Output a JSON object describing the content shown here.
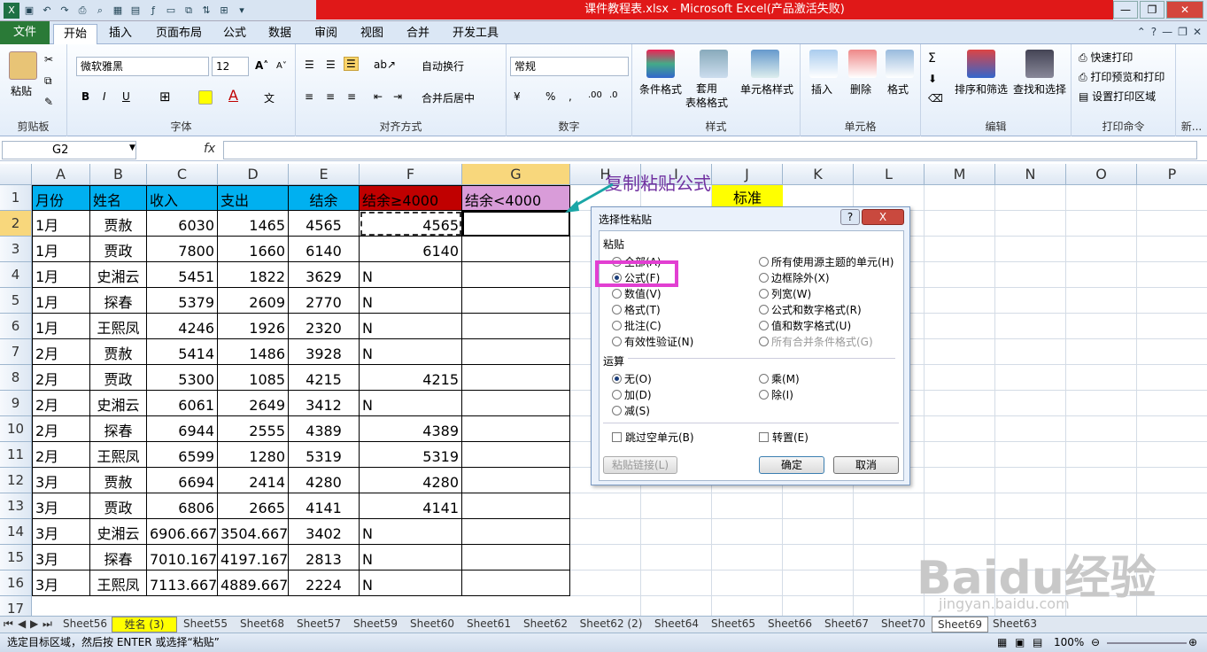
{
  "window": {
    "title": "课件教程表.xlsx - Microsoft Excel(产品激活失败)"
  },
  "ribbon": {
    "tabs": [
      "文件",
      "开始",
      "插入",
      "页面布局",
      "公式",
      "数据",
      "审阅",
      "视图",
      "合并",
      "开发工具"
    ],
    "groups": {
      "clipboard": {
        "label": "剪贴板",
        "paste": "粘贴"
      },
      "font": {
        "label": "字体",
        "name": "微软雅黑",
        "size": "12",
        "bold": "B",
        "italic": "I",
        "underline": "U"
      },
      "align": {
        "label": "对齐方式",
        "wrap": "自动换行",
        "merge": "合并后居中"
      },
      "number": {
        "label": "数字",
        "format": "常规"
      },
      "styles": {
        "label": "样式",
        "cond": "条件格式",
        "table": "套用\n表格格式",
        "cellstyle": "单元格样式"
      },
      "cells": {
        "label": "单元格",
        "insert": "插入",
        "delete": "删除",
        "format": "格式"
      },
      "edit": {
        "label": "编辑",
        "sort": "排序和筛选",
        "find": "查找和选择"
      },
      "print": {
        "label": "打印命令",
        "quick": "快速打印",
        "preview": "打印预览和打印",
        "area": "设置打印区域"
      },
      "more": {
        "label": "新..."
      }
    }
  },
  "formula_bar": {
    "name_box": "G2",
    "fx": "fx",
    "value": ""
  },
  "columns": [
    "A",
    "B",
    "C",
    "D",
    "E",
    "F",
    "G",
    "H",
    "I",
    "J",
    "K",
    "L",
    "M",
    "N",
    "O",
    "P"
  ],
  "rows": [
    "1",
    "2",
    "3",
    "4",
    "5",
    "6",
    "7",
    "8",
    "9",
    "10",
    "11",
    "12",
    "13",
    "14",
    "15",
    "16",
    "17"
  ],
  "table": {
    "headers": [
      "月份",
      "姓名",
      "收入",
      "支出",
      "结余",
      "结余≥4000",
      "结余<4000"
    ],
    "data": [
      [
        "1月",
        "贾赦",
        "6030",
        "1465",
        "4565",
        "4565",
        ""
      ],
      [
        "1月",
        "贾政",
        "7800",
        "1660",
        "6140",
        "6140",
        ""
      ],
      [
        "1月",
        "史湘云",
        "5451",
        "1822",
        "3629",
        "N",
        ""
      ],
      [
        "1月",
        "探春",
        "5379",
        "2609",
        "2770",
        "N",
        ""
      ],
      [
        "1月",
        "王熙凤",
        "4246",
        "1926",
        "2320",
        "N",
        ""
      ],
      [
        "2月",
        "贾赦",
        "5414",
        "1486",
        "3928",
        "N",
        ""
      ],
      [
        "2月",
        "贾政",
        "5300",
        "1085",
        "4215",
        "4215",
        ""
      ],
      [
        "2月",
        "史湘云",
        "6061",
        "2649",
        "3412",
        "N",
        ""
      ],
      [
        "2月",
        "探春",
        "6944",
        "2555",
        "4389",
        "4389",
        ""
      ],
      [
        "2月",
        "王熙凤",
        "6599",
        "1280",
        "5319",
        "5319",
        ""
      ],
      [
        "3月",
        "贾赦",
        "6694",
        "2414",
        "4280",
        "4280",
        ""
      ],
      [
        "3月",
        "贾政",
        "6806",
        "2665",
        "4141",
        "4141",
        ""
      ],
      [
        "3月",
        "史湘云",
        "6906.667",
        "3504.667",
        "3402",
        "N",
        ""
      ],
      [
        "3月",
        "探春",
        "7010.167",
        "4197.167",
        "2813",
        "N",
        ""
      ],
      [
        "3月",
        "王熙凤",
        "7113.667",
        "4889.667",
        "2224",
        "N",
        ""
      ]
    ],
    "standard_label": "标准"
  },
  "annotation": "复制粘贴公式",
  "dialog": {
    "title": "选择性粘贴",
    "help": "?",
    "close": "X",
    "paste_label": "粘贴",
    "paste_left": [
      "全部(A)",
      "公式(F)",
      "数值(V)",
      "格式(T)",
      "批注(C)",
      "有效性验证(N)"
    ],
    "paste_right": [
      "所有使用源主题的单元(H)",
      "边框除外(X)",
      "列宽(W)",
      "公式和数字格式(R)",
      "值和数字格式(U)",
      "所有合并条件格式(G)"
    ],
    "op_label": "运算",
    "op_left": [
      "无(O)",
      "加(D)",
      "减(S)"
    ],
    "op_right": [
      "乘(M)",
      "除(I)"
    ],
    "skip_blanks": "跳过空单元(B)",
    "transpose": "转置(E)",
    "paste_link": "粘贴链接(L)",
    "ok": "确定",
    "cancel": "取消"
  },
  "sheets": [
    "Sheet56",
    "姓名 (3)",
    "Sheet55",
    "Sheet68",
    "Sheet57",
    "Sheet59",
    "Sheet60",
    "Sheet61",
    "Sheet62",
    "Sheet62 (2)",
    "Sheet64",
    "Sheet65",
    "Sheet66",
    "Sheet67",
    "Sheet70",
    "Sheet69",
    "Sheet63"
  ],
  "status": {
    "text": "选定目标区域，然后按 ENTER 或选择“粘贴”",
    "zoom": "100%"
  },
  "watermark": {
    "main": "Baidu经验",
    "sub": "jingyan.baidu.com"
  },
  "colors": {
    "header_blue": "#00b0f0",
    "header_red": "#c00000",
    "header_pink": "#d99cd9",
    "standard_yellow": "#ffff00",
    "highlight": "#e23fd2",
    "file_tab": "#2a7a37"
  }
}
